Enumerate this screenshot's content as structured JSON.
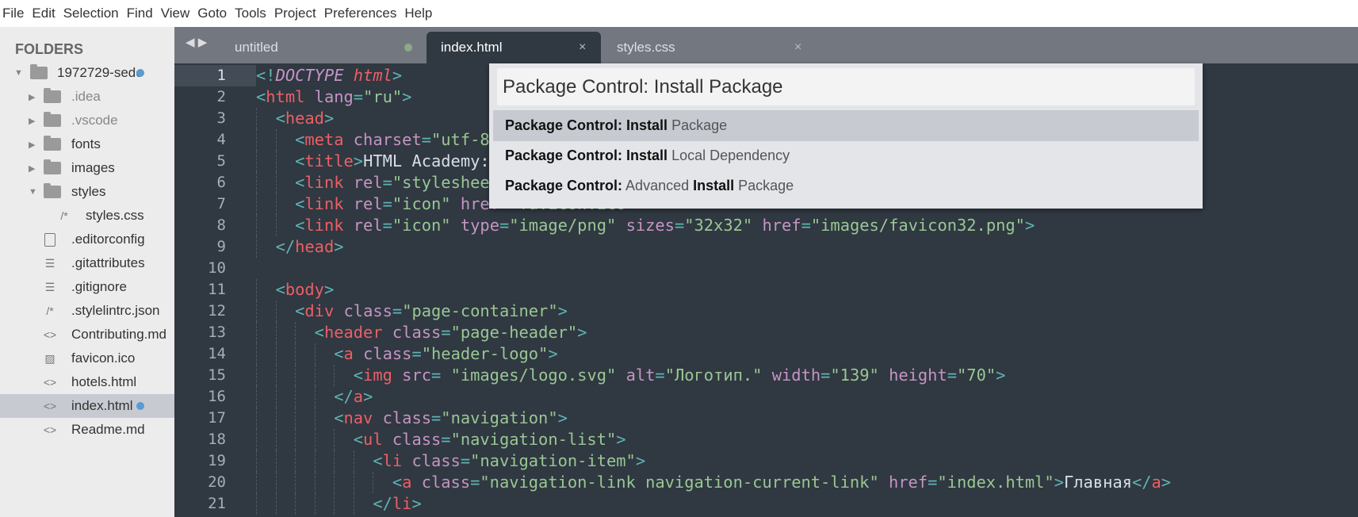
{
  "menu": [
    "File",
    "Edit",
    "Selection",
    "Find",
    "View",
    "Goto",
    "Tools",
    "Project",
    "Preferences",
    "Help"
  ],
  "sidebar": {
    "header": "FOLDERS",
    "items": [
      {
        "label": "1972729-sedc",
        "level": 0,
        "kind": "folder-open",
        "expanded": true,
        "modified": true
      },
      {
        "label": ".idea",
        "level": 1,
        "kind": "folder",
        "dim": true
      },
      {
        "label": ".vscode",
        "level": 1,
        "kind": "folder",
        "dim": true
      },
      {
        "label": "fonts",
        "level": 1,
        "kind": "folder"
      },
      {
        "label": "images",
        "level": 1,
        "kind": "folder"
      },
      {
        "label": "styles",
        "level": 1,
        "kind": "folder-open",
        "expanded": true
      },
      {
        "label": "styles.css",
        "level": 2,
        "kind": "comment-file",
        "icon": "/*"
      },
      {
        "label": ".editorconfig",
        "level": 1,
        "kind": "file"
      },
      {
        "label": ".gitattributes",
        "level": 1,
        "kind": "text-file",
        "icon": "☰"
      },
      {
        "label": ".gitignore",
        "level": 1,
        "kind": "text-file",
        "icon": "☰"
      },
      {
        "label": ".stylelintrc.json",
        "level": 1,
        "kind": "comment-file",
        "icon": "/*"
      },
      {
        "label": "Contributing.md",
        "level": 1,
        "kind": "code-file",
        "icon": "<>"
      },
      {
        "label": "favicon.ico",
        "level": 1,
        "kind": "image-file",
        "icon": "▨"
      },
      {
        "label": "hotels.html",
        "level": 1,
        "kind": "code-file",
        "icon": "<>"
      },
      {
        "label": "index.html",
        "level": 1,
        "kind": "code-file",
        "icon": "<>",
        "selected": true,
        "modified": true
      },
      {
        "label": "Readme.md",
        "level": 1,
        "kind": "code-file",
        "icon": "<>"
      }
    ]
  },
  "tabs": [
    {
      "label": "untitled",
      "modified": true
    },
    {
      "label": "index.html",
      "active": true,
      "close": "×"
    },
    {
      "label": "styles.css",
      "close": "×"
    }
  ],
  "palette": {
    "query": "Package Control: Install Package",
    "results": [
      {
        "parts": [
          [
            "b",
            "Package Control: Install"
          ],
          [
            "n",
            " Package"
          ]
        ],
        "selected": true
      },
      {
        "parts": [
          [
            "b",
            "Package Control: Install"
          ],
          [
            "n",
            " Local Dependency"
          ]
        ]
      },
      {
        "parts": [
          [
            "b",
            "Package Control:"
          ],
          [
            "n",
            " Advanced "
          ],
          [
            "b",
            "Install"
          ],
          [
            "n",
            " Package"
          ]
        ]
      }
    ]
  },
  "editor": {
    "current_line": 1,
    "colors": {
      "tag": "#ec5f66",
      "attr": "#c594c5",
      "string": "#99c794",
      "punct": "#5fb3b3",
      "text": "#d8dee9",
      "bg": "#303841"
    },
    "lines": [
      {
        "i": 0,
        "tk": [
          [
            "p",
            "<!"
          ],
          [
            "d",
            "DOCTYPE"
          ],
          [
            "x",
            " "
          ],
          [
            "k",
            "html"
          ],
          [
            "p",
            ">"
          ]
        ]
      },
      {
        "i": 0,
        "tk": [
          [
            "p",
            "<"
          ],
          [
            "t",
            "html"
          ],
          [
            "x",
            " "
          ],
          [
            "a",
            "lang"
          ],
          [
            "p",
            "="
          ],
          [
            "s",
            "\"ru\""
          ],
          [
            "p",
            ">"
          ]
        ]
      },
      {
        "i": 1,
        "tk": [
          [
            "p",
            "<"
          ],
          [
            "t",
            "head"
          ],
          [
            "p",
            ">"
          ]
        ]
      },
      {
        "i": 2,
        "tk": [
          [
            "p",
            "<"
          ],
          [
            "t",
            "meta"
          ],
          [
            "x",
            " "
          ],
          [
            "a",
            "charset"
          ],
          [
            "p",
            "="
          ],
          [
            "s",
            "\"utf-8"
          ]
        ]
      },
      {
        "i": 2,
        "tk": [
          [
            "p",
            "<"
          ],
          [
            "t",
            "title"
          ],
          [
            "p",
            ">"
          ],
          [
            "x",
            "HTML Academy:"
          ]
        ]
      },
      {
        "i": 2,
        "tk": [
          [
            "p",
            "<"
          ],
          [
            "t",
            "link"
          ],
          [
            "x",
            " "
          ],
          [
            "a",
            "rel"
          ],
          [
            "p",
            "="
          ],
          [
            "s",
            "\"styleshee"
          ]
        ]
      },
      {
        "i": 2,
        "tk": [
          [
            "p",
            "<"
          ],
          [
            "t",
            "link"
          ],
          [
            "x",
            " "
          ],
          [
            "a",
            "rel"
          ],
          [
            "p",
            "="
          ],
          [
            "s",
            "\"icon\""
          ],
          [
            "x",
            " "
          ],
          [
            "a",
            "href"
          ],
          [
            "p",
            "="
          ],
          [
            "s",
            "\"favicon.ico\""
          ],
          [
            "p",
            ">"
          ]
        ]
      },
      {
        "i": 2,
        "tk": [
          [
            "p",
            "<"
          ],
          [
            "t",
            "link"
          ],
          [
            "x",
            " "
          ],
          [
            "a",
            "rel"
          ],
          [
            "p",
            "="
          ],
          [
            "s",
            "\"icon\""
          ],
          [
            "x",
            " "
          ],
          [
            "a",
            "type"
          ],
          [
            "p",
            "="
          ],
          [
            "s",
            "\"image/png\""
          ],
          [
            "x",
            " "
          ],
          [
            "a",
            "sizes"
          ],
          [
            "p",
            "="
          ],
          [
            "s",
            "\"32x32\""
          ],
          [
            "x",
            " "
          ],
          [
            "a",
            "href"
          ],
          [
            "p",
            "="
          ],
          [
            "s",
            "\"images/favicon32.png\""
          ],
          [
            "p",
            ">"
          ]
        ]
      },
      {
        "i": 1,
        "tk": [
          [
            "p",
            "</"
          ],
          [
            "t",
            "head"
          ],
          [
            "p",
            ">"
          ]
        ]
      },
      {
        "i": 0,
        "tk": []
      },
      {
        "i": 1,
        "tk": [
          [
            "p",
            "<"
          ],
          [
            "t",
            "body"
          ],
          [
            "p",
            ">"
          ]
        ]
      },
      {
        "i": 2,
        "tk": [
          [
            "p",
            "<"
          ],
          [
            "t",
            "div"
          ],
          [
            "x",
            " "
          ],
          [
            "a",
            "class"
          ],
          [
            "p",
            "="
          ],
          [
            "s",
            "\"page-container\""
          ],
          [
            "p",
            ">"
          ]
        ]
      },
      {
        "i": 3,
        "tk": [
          [
            "p",
            "<"
          ],
          [
            "t",
            "header"
          ],
          [
            "x",
            " "
          ],
          [
            "a",
            "class"
          ],
          [
            "p",
            "="
          ],
          [
            "s",
            "\"page-header\""
          ],
          [
            "p",
            ">"
          ]
        ]
      },
      {
        "i": 4,
        "tk": [
          [
            "p",
            "<"
          ],
          [
            "t",
            "a"
          ],
          [
            "x",
            " "
          ],
          [
            "a",
            "class"
          ],
          [
            "p",
            "="
          ],
          [
            "s",
            "\"header-logo\""
          ],
          [
            "p",
            ">"
          ]
        ]
      },
      {
        "i": 5,
        "tk": [
          [
            "p",
            "<"
          ],
          [
            "t",
            "img"
          ],
          [
            "x",
            " "
          ],
          [
            "a",
            "src"
          ],
          [
            "p",
            "="
          ],
          [
            "x",
            " "
          ],
          [
            "s",
            "\"images/logo.svg\""
          ],
          [
            "x",
            " "
          ],
          [
            "a",
            "alt"
          ],
          [
            "p",
            "="
          ],
          [
            "s",
            "\"Логотип.\""
          ],
          [
            "x",
            " "
          ],
          [
            "a",
            "width"
          ],
          [
            "p",
            "="
          ],
          [
            "s",
            "\"139\""
          ],
          [
            "x",
            " "
          ],
          [
            "a",
            "height"
          ],
          [
            "p",
            "="
          ],
          [
            "s",
            "\"70\""
          ],
          [
            "p",
            ">"
          ]
        ]
      },
      {
        "i": 4,
        "tk": [
          [
            "p",
            "</"
          ],
          [
            "t",
            "a"
          ],
          [
            "p",
            ">"
          ]
        ]
      },
      {
        "i": 4,
        "tk": [
          [
            "p",
            "<"
          ],
          [
            "t",
            "nav"
          ],
          [
            "x",
            " "
          ],
          [
            "a",
            "class"
          ],
          [
            "p",
            "="
          ],
          [
            "s",
            "\"navigation\""
          ],
          [
            "p",
            ">"
          ]
        ]
      },
      {
        "i": 5,
        "tk": [
          [
            "p",
            "<"
          ],
          [
            "t",
            "ul"
          ],
          [
            "x",
            " "
          ],
          [
            "a",
            "class"
          ],
          [
            "p",
            "="
          ],
          [
            "s",
            "\"navigation-list\""
          ],
          [
            "p",
            ">"
          ]
        ]
      },
      {
        "i": 6,
        "tk": [
          [
            "p",
            "<"
          ],
          [
            "t",
            "li"
          ],
          [
            "x",
            " "
          ],
          [
            "a",
            "class"
          ],
          [
            "p",
            "="
          ],
          [
            "s",
            "\"navigation-item\""
          ],
          [
            "p",
            ">"
          ]
        ]
      },
      {
        "i": 7,
        "tk": [
          [
            "p",
            "<"
          ],
          [
            "t",
            "a"
          ],
          [
            "x",
            " "
          ],
          [
            "a",
            "class"
          ],
          [
            "p",
            "="
          ],
          [
            "s",
            "\"navigation-link navigation-current-link\""
          ],
          [
            "x",
            " "
          ],
          [
            "a",
            "href"
          ],
          [
            "p",
            "="
          ],
          [
            "s",
            "\"index.html\""
          ],
          [
            "p",
            ">"
          ],
          [
            "x",
            "Главная"
          ],
          [
            "p",
            "</"
          ],
          [
            "t",
            "a"
          ],
          [
            "p",
            ">"
          ]
        ]
      },
      {
        "i": 6,
        "tk": [
          [
            "p",
            "</"
          ],
          [
            "t",
            "li"
          ],
          [
            "p",
            ">"
          ]
        ]
      }
    ]
  }
}
